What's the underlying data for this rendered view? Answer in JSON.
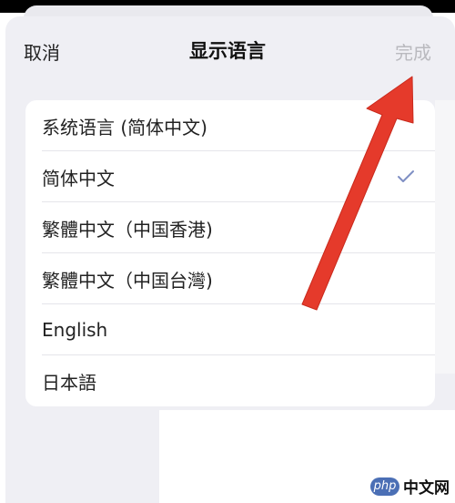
{
  "header": {
    "cancel_label": "取消",
    "title": "显示语言",
    "done_label": "完成"
  },
  "languages": [
    {
      "label": "系统语言 (简体中文)",
      "selected": false
    },
    {
      "label": "简体中文",
      "selected": true
    },
    {
      "label": "繁體中文（中国香港)",
      "selected": false
    },
    {
      "label": "繁體中文（中国台灣)",
      "selected": false
    },
    {
      "label": "English",
      "selected": false
    },
    {
      "label": "日本語",
      "selected": false
    }
  ],
  "watermark": {
    "logo_text": "php",
    "site_text": "中文网"
  },
  "colors": {
    "accent_check": "#7f8fc4",
    "arrow": "#e53a2b",
    "disabled_text": "#b9b9be"
  },
  "icons": {
    "selected": "checkmark-icon",
    "annotation": "red-arrow-icon"
  }
}
